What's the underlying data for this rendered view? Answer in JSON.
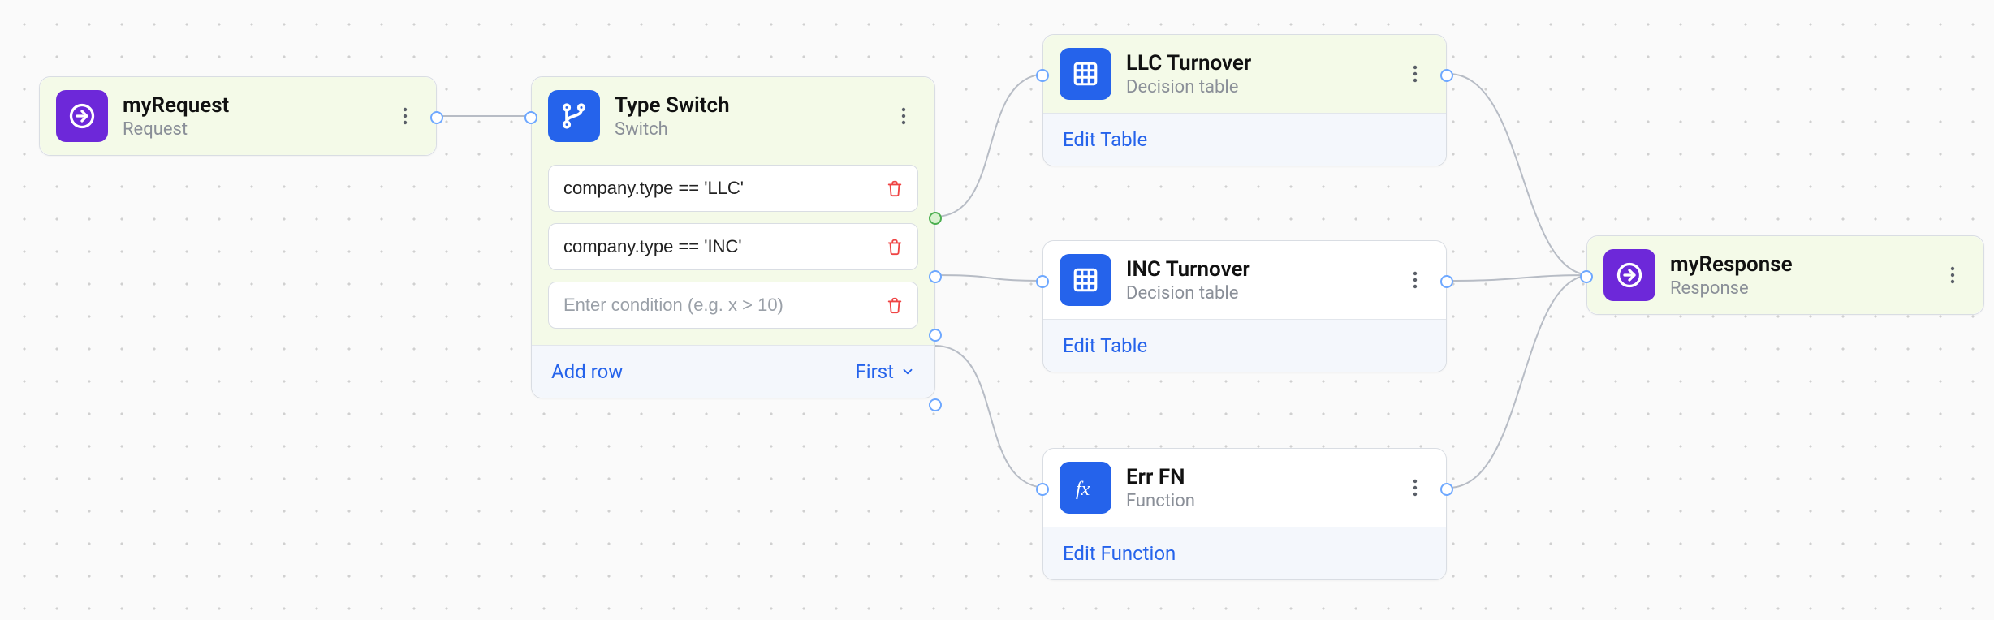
{
  "nodes": {
    "request": {
      "title": "myRequest",
      "subtitle": "Request"
    },
    "switch": {
      "title": "Type Switch",
      "subtitle": "Switch",
      "conditions": [
        {
          "value": "company.type == 'LLC'"
        },
        {
          "value": "company.type == 'INC'"
        },
        {
          "value": ""
        }
      ],
      "placeholder": "Enter condition (e.g. x > 10)",
      "addRowLabel": "Add row",
      "modeLabel": "First"
    },
    "llc": {
      "title": "LLC Turnover",
      "subtitle": "Decision table",
      "editLabel": "Edit Table"
    },
    "inc": {
      "title": "INC Turnover",
      "subtitle": "Decision table",
      "editLabel": "Edit Table"
    },
    "err": {
      "title": "Err FN",
      "subtitle": "Function",
      "editLabel": "Edit Function"
    },
    "response": {
      "title": "myResponse",
      "subtitle": "Response"
    }
  },
  "icons": {
    "request": "request-arrow",
    "switch": "branch",
    "table": "grid",
    "function": "fx",
    "response": "response-arrow"
  }
}
